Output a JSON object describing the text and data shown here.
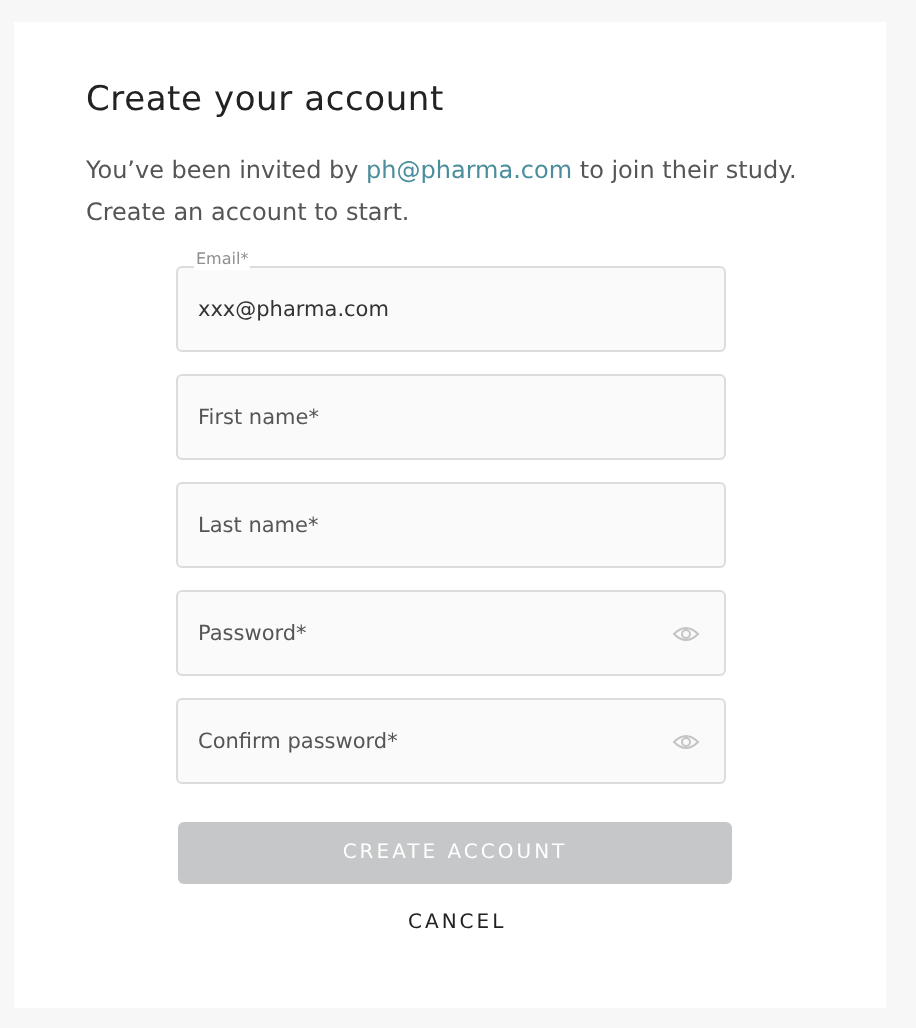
{
  "title": "Create your account",
  "intro": {
    "before": "You’ve been invited by ",
    "link": "ph@pharma.com",
    "after": " to join their study. Create an account to start."
  },
  "fields": [
    {
      "kind": "email",
      "label": "Email*",
      "value": "xxx@pharma.com"
    },
    {
      "kind": "text",
      "placeholder": "First name*"
    },
    {
      "kind": "text",
      "placeholder": "Last name*"
    },
    {
      "kind": "password",
      "placeholder": "Password*"
    },
    {
      "kind": "password",
      "placeholder": "Confirm password*"
    }
  ],
  "create_button": {
    "label": "CREATE ACCOUNT",
    "disabled": true
  },
  "cancel_button": {
    "label": "CANCEL"
  }
}
